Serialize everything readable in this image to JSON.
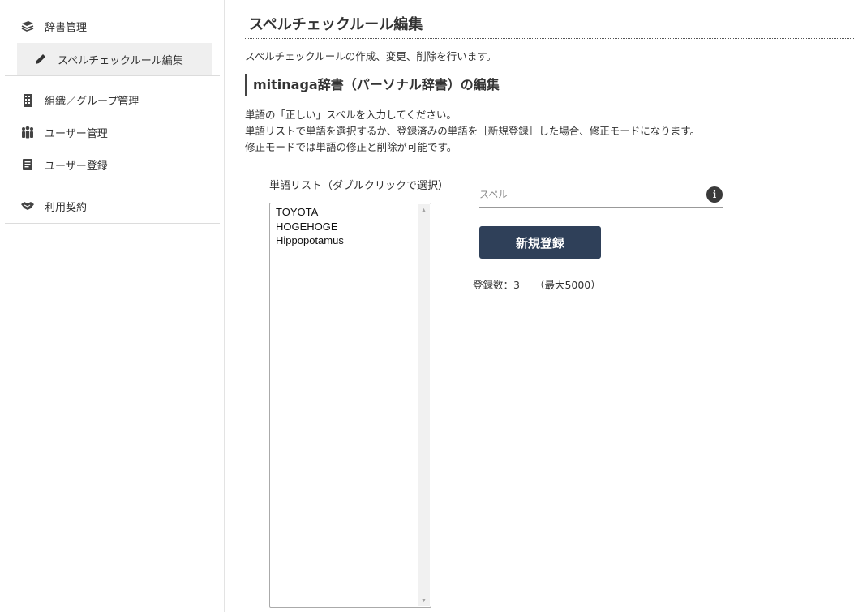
{
  "sidebar": {
    "items": [
      {
        "label": "辞書管理",
        "icon": "book-icon"
      },
      {
        "label": "スペルチェックルール編集",
        "icon": "pencil-icon"
      },
      {
        "label": "組織／グループ管理",
        "icon": "building-icon"
      },
      {
        "label": "ユーザー管理",
        "icon": "users-icon"
      },
      {
        "label": "ユーザー登録",
        "icon": "document-icon"
      },
      {
        "label": "利用契約",
        "icon": "handshake-icon"
      }
    ]
  },
  "main": {
    "title": "スペルチェックルール編集",
    "description": "スペルチェックルールの作成、変更、削除を行います。",
    "section_title": "mitinaga辞書（パーソナル辞書）の編集",
    "instructions": [
      "単語の「正しい」スペルを入力してください。",
      "単語リストで単語を選択するか、登録済みの単語を［新規登録］した場合、修正モードになります。",
      "修正モードでは単語の修正と削除が可能です。"
    ],
    "word_list": {
      "label": "単語リスト（ダブルクリックで選択）",
      "items": [
        "TOYOTA",
        "HOGEHOGE",
        "Hippopotamus"
      ]
    },
    "spell_input": {
      "placeholder": "スペル",
      "value": ""
    },
    "register_button": "新規登録",
    "count": {
      "label": "登録数：3",
      "max": "（最大5000）"
    }
  },
  "colors": {
    "button_bg": "#2f4059",
    "active_nav_bg": "#efefef"
  }
}
